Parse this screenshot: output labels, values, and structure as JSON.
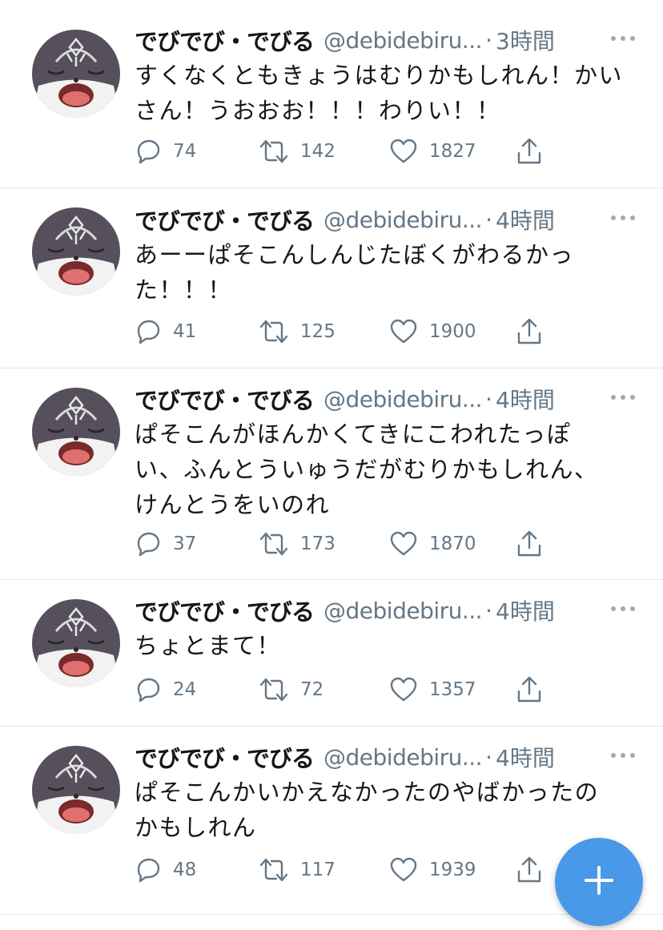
{
  "tweets": [
    {
      "name": "でびでび・でびる",
      "handle": "@debidebiru...",
      "separator": "·",
      "time": "3時間",
      "text": "すくなくともきょうはむりかもしれん！かいさん！うおおお！！！わりい！！",
      "replies": "74",
      "retweets": "142",
      "likes": "1827"
    },
    {
      "name": "でびでび・でびる",
      "handle": "@debidebiru...",
      "separator": "·",
      "time": "4時間",
      "text": "あーーぱそこんしんじたぼくがわるかった！！！",
      "replies": "41",
      "retweets": "125",
      "likes": "1900"
    },
    {
      "name": "でびでび・でびる",
      "handle": "@debidebiru...",
      "separator": "·",
      "time": "4時間",
      "text": "ぱそこんがほんかくてきにこわれたっぽい、ふんとういゅうだがむりかもしれん、けんとうをいのれ",
      "replies": "37",
      "retweets": "173",
      "likes": "1870"
    },
    {
      "name": "でびでび・でびる",
      "handle": "@debidebiru...",
      "separator": "·",
      "time": "4時間",
      "text": "ちょとまて！",
      "replies": "24",
      "retweets": "72",
      "likes": "1357"
    },
    {
      "name": "でびでび・でびる",
      "handle": "@debidebiru...",
      "separator": "·",
      "time": "4時間",
      "text": "ぱそこんかいかえなかったのやばかったのかもしれん",
      "replies": "48",
      "retweets": "117",
      "likes": "1939"
    }
  ],
  "icons": {
    "reply": "reply-icon",
    "retweet": "retweet-icon",
    "like": "heart-icon",
    "share": "share-icon",
    "more": "more-icon",
    "compose": "plus-icon"
  },
  "colors": {
    "text": "#14171a",
    "secondary": "#657786",
    "divider": "#e1e8ed",
    "fab": "#4a99e9"
  }
}
